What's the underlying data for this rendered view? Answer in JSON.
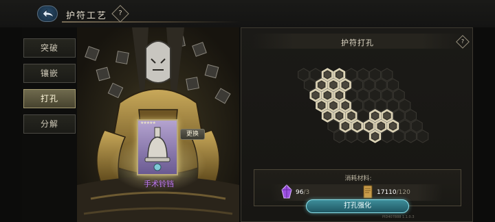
{
  "header": {
    "title": "护符工艺",
    "back_icon": "back-arrow-icon",
    "help_icon": "question-diamond-icon",
    "help_glyph": "?"
  },
  "menu": {
    "items": [
      {
        "label": "突破",
        "active": false
      },
      {
        "label": "镶嵌",
        "active": false
      },
      {
        "label": "打孔",
        "active": true
      },
      {
        "label": "分解",
        "active": false
      }
    ]
  },
  "card": {
    "name": "手术铃铛",
    "stars": "★★★★★",
    "swap_label": "更换",
    "icon": "bell-icon"
  },
  "panel": {
    "title": "护符打孔",
    "help_glyph": "?",
    "hex_board": {
      "rings": [
        {
          "name": "opened",
          "count": 22
        },
        {
          "name": "locked",
          "count": 27
        }
      ]
    },
    "materials": {
      "title": "消耗材料:",
      "items": [
        {
          "icon": "purple-crystal-icon",
          "have": "96",
          "need": "/3"
        },
        {
          "icon": "scroll-icon",
          "have": "17110",
          "need": "/120"
        }
      ]
    },
    "action_label": "打孔强化",
    "accent": "#8de4ee"
  },
  "version": "PID407888 1.1.0.3"
}
